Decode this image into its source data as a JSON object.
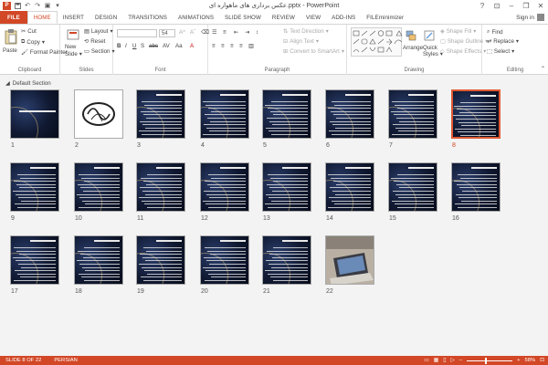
{
  "window": {
    "title": "عکس برداری های ماهواره ای.pptx - PowerPoint",
    "help": "?",
    "minimize": "–",
    "restore": "❐",
    "close": "✕"
  },
  "tabs": [
    "FILE",
    "HOME",
    "INSERT",
    "DESIGN",
    "TRANSITIONS",
    "ANIMATIONS",
    "SLIDE SHOW",
    "REVIEW",
    "VIEW",
    "ADD-INS",
    "FILEminimizer"
  ],
  "active_tab": "HOME",
  "signin": "Sign in",
  "ribbon": {
    "clipboard": {
      "paste": "Paste",
      "cut": "Cut",
      "copy": "Copy",
      "format_painter": "Format Painter",
      "label": "Clipboard"
    },
    "slides": {
      "new_slide": "New",
      "new_slide2": "Slide",
      "layout": "Layout",
      "reset": "Reset",
      "section": "Section",
      "label": "Slides"
    },
    "font": {
      "size": "54",
      "label": "Font"
    },
    "paragraph": {
      "text_direction": "Text Direction",
      "align_text": "Align Text",
      "convert_smartart": "Convert to SmartArt",
      "label": "Paragraph"
    },
    "drawing": {
      "arrange": "Arrange",
      "quick_styles": "Quick",
      "quick_styles2": "Styles",
      "shape_fill": "Shape Fill",
      "shape_outline": "Shape Outline",
      "shape_effects": "Shape Effects",
      "label": "Drawing"
    },
    "editing": {
      "find": "Find",
      "replace": "Replace",
      "select": "Select",
      "label": "Editing"
    }
  },
  "section_name": "Default Section",
  "slides": [
    {
      "n": "1",
      "kind": "title"
    },
    {
      "n": "2",
      "kind": "white"
    },
    {
      "n": "3",
      "kind": "text"
    },
    {
      "n": "4",
      "kind": "text"
    },
    {
      "n": "5",
      "kind": "text"
    },
    {
      "n": "6",
      "kind": "text"
    },
    {
      "n": "7",
      "kind": "text"
    },
    {
      "n": "8",
      "kind": "text"
    },
    {
      "n": "9",
      "kind": "text"
    },
    {
      "n": "10",
      "kind": "text"
    },
    {
      "n": "11",
      "kind": "text"
    },
    {
      "n": "12",
      "kind": "text"
    },
    {
      "n": "13",
      "kind": "text"
    },
    {
      "n": "14",
      "kind": "text"
    },
    {
      "n": "15",
      "kind": "text"
    },
    {
      "n": "16",
      "kind": "text"
    },
    {
      "n": "17",
      "kind": "text"
    },
    {
      "n": "18",
      "kind": "text"
    },
    {
      "n": "19",
      "kind": "text"
    },
    {
      "n": "20",
      "kind": "text"
    },
    {
      "n": "21",
      "kind": "text"
    },
    {
      "n": "22",
      "kind": "photo"
    }
  ],
  "selected_slide": "8",
  "status": {
    "slide_info": "SLIDE 8 OF 22",
    "language": "PERSIAN",
    "zoom": "58%"
  },
  "colors": {
    "accent": "#d24726",
    "selected_border": "#e05a33",
    "slide_bg": "#0f1a33"
  }
}
